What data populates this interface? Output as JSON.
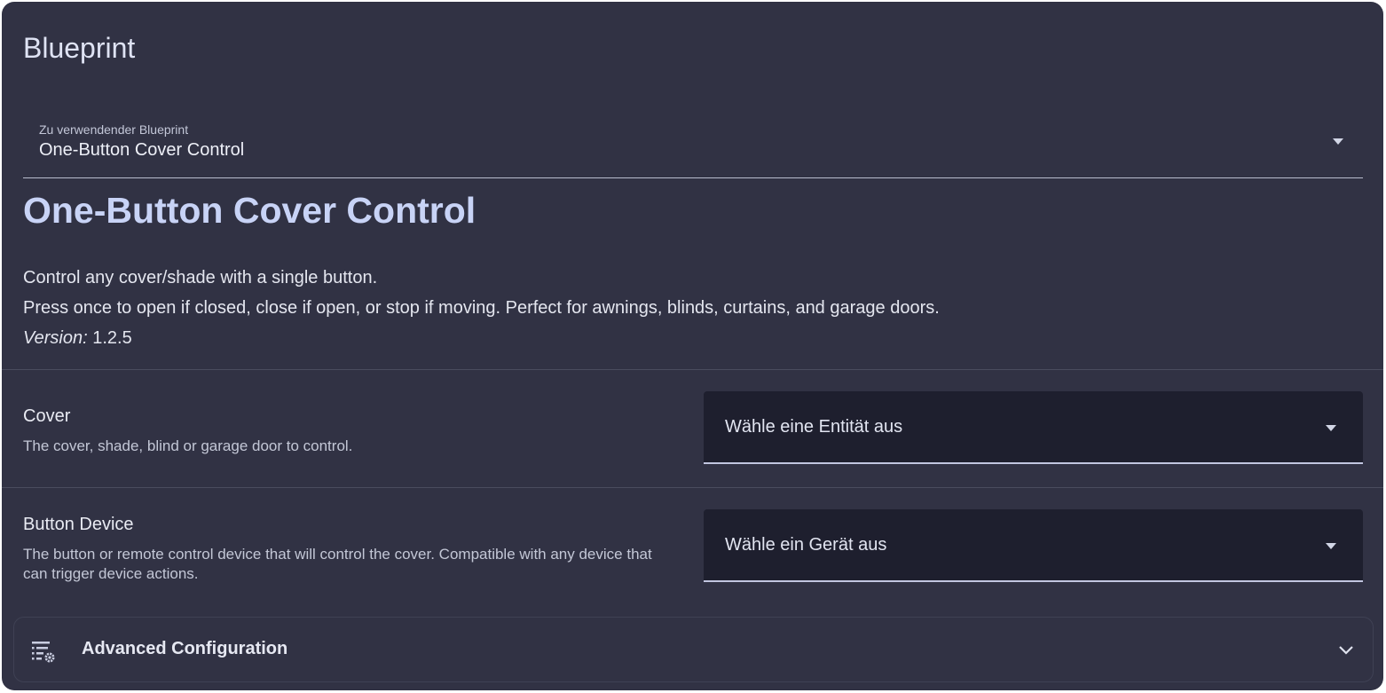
{
  "section_title": "Blueprint",
  "blueprint_select": {
    "label": "Zu verwendender Blueprint",
    "value": "One-Button Cover Control"
  },
  "blueprint": {
    "name": "One-Button Cover Control",
    "description_line1": "Control any cover/shade with a single button.",
    "description_line2": "Press once to open if closed, close if open, or stop if moving. Perfect for awnings, blinds, curtains, and garage doors.",
    "version_label": "Version:",
    "version": "1.2.5"
  },
  "inputs": [
    {
      "label": "Cover",
      "description": "The cover, shade, blind or garage door to control.",
      "placeholder": "Wähle eine Entität aus"
    },
    {
      "label": "Button Device",
      "description": "The button or remote control device that will control the cover. Compatible with any device that can trigger device actions.",
      "placeholder": "Wähle ein Gerät aus"
    }
  ],
  "advanced": {
    "label": "Advanced Configuration",
    "icon": "settings-list-icon",
    "expand_icon": "chevron-down-icon"
  },
  "colors": {
    "card_background": "#313244",
    "picker_background": "#1e1f2e",
    "heading_accent": "#c8d3f6"
  }
}
